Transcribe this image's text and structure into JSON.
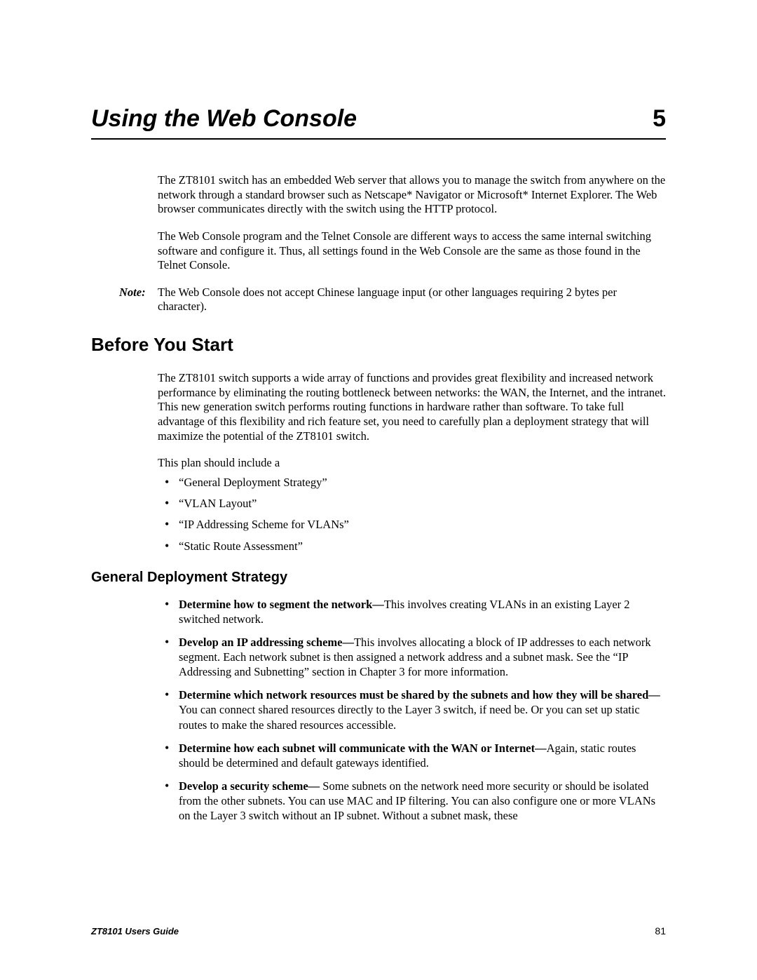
{
  "chapter": {
    "title": "Using the Web Console",
    "number": "5"
  },
  "intro": {
    "p1": "The ZT8101 switch has an embedded Web server that allows you to manage the switch from anywhere on the network through a standard browser such as Netscape* Navigator or Microsoft* Internet Explorer. The Web browser communicates directly with the switch using the HTTP protocol.",
    "p2": "The Web Console program and the Telnet Console are different ways to access the same internal switching software and configure it. Thus, all settings found in the Web Console are the same as those found in the Telnet Console."
  },
  "note": {
    "label": "Note:",
    "text": "The Web Console does not accept Chinese language input (or other languages requiring 2 bytes per character)."
  },
  "section1": {
    "heading": "Before You Start",
    "p1": "The ZT8101 switch supports a wide array of functions and provides great flexibility and increased network performance by eliminating the routing bottleneck between networks: the WAN, the Internet, and the intranet. This new generation switch performs routing functions in hardware rather than software. To take full advantage of this flexibility and rich feature set, you need to carefully plan a deployment strategy that will maximize the potential of the ZT8101 switch.",
    "p2": "This plan should include a",
    "bullets": [
      "“General Deployment Strategy”",
      "“VLAN Layout”",
      "“IP Addressing Scheme for VLANs”",
      "“Static Route Assessment”"
    ]
  },
  "section2": {
    "heading": "General Deployment Strategy",
    "items": [
      {
        "bold": "Determine how to segment the network—",
        "text": "This involves creating VLANs in an existing Layer 2 switched network."
      },
      {
        "bold": "Develop an IP addressing scheme—",
        "text": "This involves allocating a block of IP addresses to each network segment. Each network subnet is then assigned a network address and a subnet mask. See the “IP Addressing and Subnetting” section in Chapter 3 for more information."
      },
      {
        "bold": "Determine which network resources must be shared by the subnets and how they will be shared—",
        "text": "You can connect shared resources directly to the Layer 3 switch, if need be. Or you can set up static routes to make the shared resources accessible."
      },
      {
        "bold": "Determine how each subnet will communicate with the WAN or Internet—",
        "text": "Again, static routes should be determined and default gateways identified."
      },
      {
        "bold": "Develop a security scheme—",
        "text": " Some subnets on the network need more security or should be isolated from the other subnets. You can use MAC and IP filtering. You can also configure one or more VLANs on the Layer 3 switch without an IP subnet. Without a subnet mask, these"
      }
    ]
  },
  "footer": {
    "guide": "ZT8101 Users Guide",
    "page": "81"
  }
}
